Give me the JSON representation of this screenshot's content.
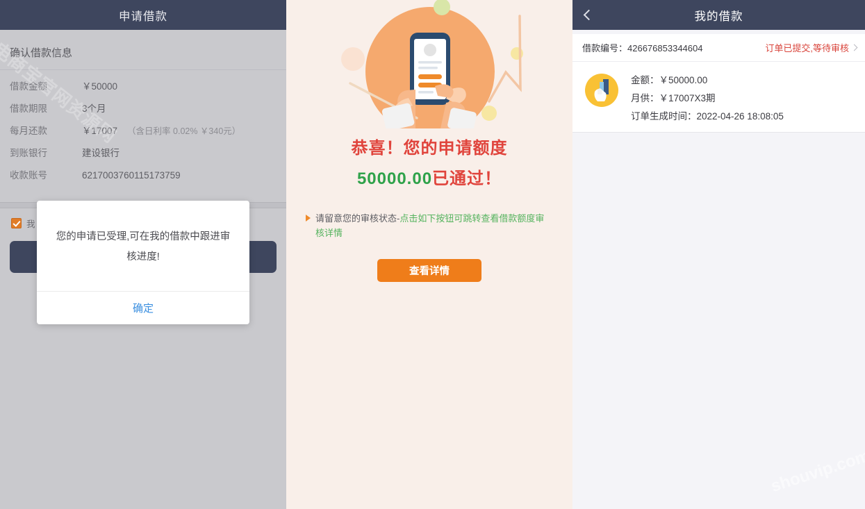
{
  "left_panel": {
    "header_title": "申请借款",
    "section_title": "确认借款信息",
    "rows": [
      {
        "label": "借款金额",
        "value": "￥50000",
        "note": ""
      },
      {
        "label": "借款期限",
        "value": "3个月",
        "note": ""
      },
      {
        "label": "每月还款",
        "value": "￥17007",
        "note": "（含日利率 0.02% ￥340元）"
      },
      {
        "label": "到账银行",
        "value": "建设银行",
        "note": ""
      },
      {
        "label": "收款账号",
        "value": "6217003760115173759",
        "note": ""
      }
    ],
    "agree_text": "我",
    "submit_label": "",
    "watermark": "电商宝官网资源网",
    "watermark_url": "shouvip.com"
  },
  "dialog": {
    "message": "您的申请已受理,可在我的借款中跟进审核进度!",
    "confirm_label": "确定"
  },
  "middle_panel": {
    "headline_prefix": "恭喜！",
    "headline_rest": "您的申请额度",
    "amount": "50000.00",
    "amount_suffix": "已通过！",
    "note_dark": "请留意您的审核状态-",
    "note_green": "点击如下按钮可跳转查看借款额度审核详情",
    "detail_button": "查看详情",
    "accent_color": "#ef7d1a",
    "red_color": "#e0443c",
    "green_color": "#2fa24a"
  },
  "right_panel": {
    "header_title": "我的借款",
    "order_no_label": "借款编号：",
    "order_no_value": "426676853344604",
    "status_text": "订单已提交,等待审核",
    "status_color": "#d9443b",
    "card": {
      "amount_line": "金额：￥50000.00",
      "monthly_line": "月供：￥17007X3期",
      "time_line": "订单生成时间：2022-04-26 18:08:05"
    }
  }
}
